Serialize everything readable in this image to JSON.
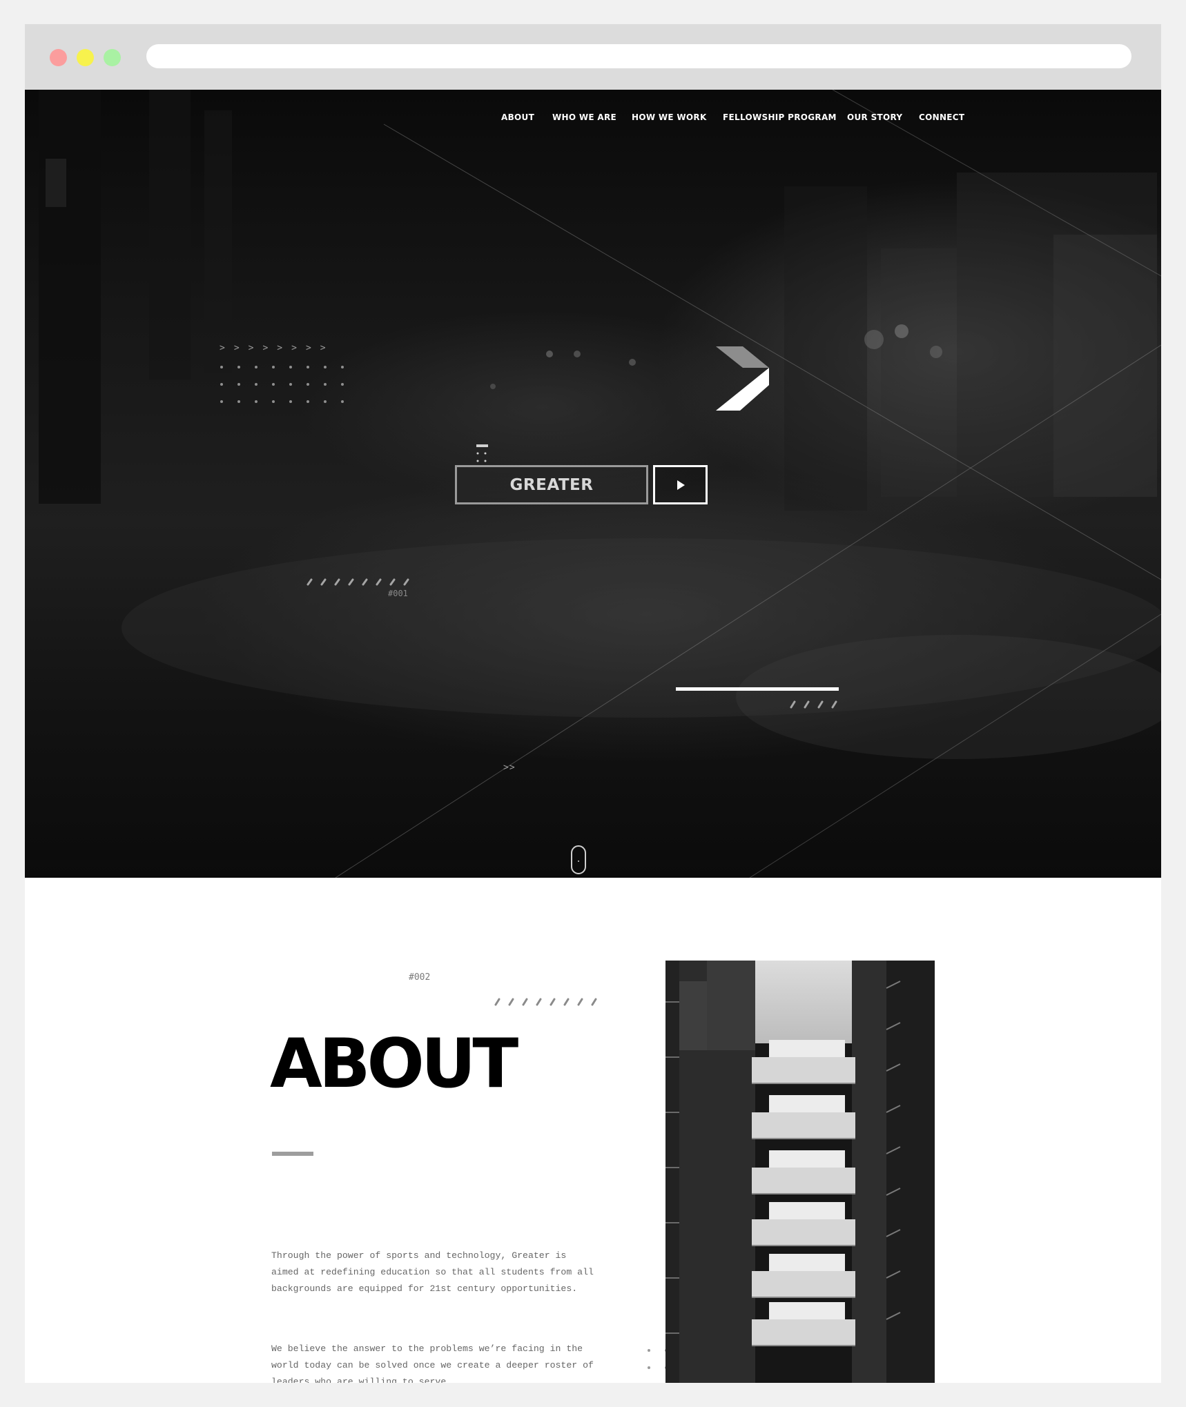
{
  "nav": {
    "items": [
      {
        "label": "ABOUT"
      },
      {
        "label": "WHO WE ARE"
      },
      {
        "label": "HOW WE WORK"
      },
      {
        "label": "FELLOWSHIP PROGRAM"
      },
      {
        "label": "OUR STORY"
      },
      {
        "label": "CONNECT"
      }
    ]
  },
  "hero": {
    "button_label": "GREATER",
    "play_icon": "play-icon",
    "logo_icon": "chevron-logo-icon",
    "label_001": "#001",
    "chevrons_small": ">>",
    "scroll_icon": "mouse-scroll-icon"
  },
  "about": {
    "number": "#002",
    "title": "ABOUT",
    "paragraph_1": "Through the power of sports and technology, Greater is aimed at redefining education so that all students from all backgrounds are equipped for 21st century opportunities.",
    "paragraph_2": "We believe the answer to the problems we’re facing in the world today can be solved once we create a deeper roster of leaders who are willing to serve."
  },
  "colors": {
    "chrome": "#dcdcdc",
    "dot_red": "#fb9d9d",
    "dot_yellow": "#f7f24d",
    "dot_green": "#a9f1a3",
    "hero_dark": "#111111",
    "accent_grey": "#9d9d9d"
  }
}
